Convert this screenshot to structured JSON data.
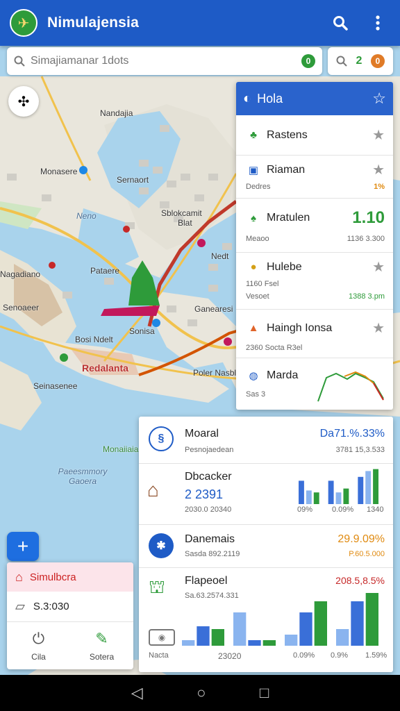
{
  "app": {
    "title": "Nimulajensia"
  },
  "search": {
    "placeholder": "Simajiamanar 1dots",
    "badge": "0",
    "right_value": "2",
    "right_badge": "0"
  },
  "map_labels": [
    {
      "text": "Nandajia",
      "cls": ""
    },
    {
      "text": "Monasere",
      "cls": ""
    },
    {
      "text": "Sernaort",
      "cls": ""
    },
    {
      "text": "Neno",
      "cls": "water"
    },
    {
      "text": "Sblokcamit",
      "cls": ""
    },
    {
      "text": "Blat",
      "cls": ""
    },
    {
      "text": "Nedt",
      "cls": ""
    },
    {
      "text": "Pataere",
      "cls": ""
    },
    {
      "text": "Nagadiano",
      "cls": ""
    },
    {
      "text": "Ganearesi",
      "cls": ""
    },
    {
      "text": "Sonisa",
      "cls": ""
    },
    {
      "text": "Bosi Ndelt",
      "cls": ""
    },
    {
      "text": "Senoaeer",
      "cls": ""
    },
    {
      "text": "Redalanta",
      "cls": "red"
    },
    {
      "text": "Poler Nasbl",
      "cls": ""
    },
    {
      "text": "Seinasenee",
      "cls": ""
    },
    {
      "text": "Monaiiaia",
      "cls": "green"
    },
    {
      "text": "Paeesmmory Gaoera",
      "cls": "water"
    }
  ],
  "panel": {
    "title": "Hola",
    "items": [
      {
        "name": "Rastens",
        "sub": "",
        "value": "",
        "star": true,
        "icon": "tree-icon"
      },
      {
        "name": "Riaman",
        "sub": "Dedres",
        "value": "1%",
        "star": true,
        "icon": "building-icon"
      },
      {
        "name": "Mratulen",
        "sub": "Meaoo",
        "value": "1.10",
        "sub_value": "1136 3.300",
        "star": false,
        "icon": "forest-icon"
      },
      {
        "name": "Hulebe",
        "sub": "1160 Fsel",
        "value": "",
        "sub2": "Vesoet",
        "sub2_value": "1388 3.pm",
        "star": true,
        "icon": "coin-icon"
      },
      {
        "name": "Haingh Ionsa",
        "sub": "2360 Socta R3el",
        "value": "",
        "star": true,
        "icon": "tent-icon"
      },
      {
        "name": "Marda",
        "sub": "Sas 3",
        "value": "",
        "star": false,
        "icon": "globe-icon"
      }
    ]
  },
  "card": {
    "sec1": {
      "title": "Moaral",
      "sub": "Pesnojaedean",
      "value": "Da71.%.33%",
      "sub_value": "3781 15,3.533"
    },
    "sec2": {
      "title": "Dbcacker",
      "value": "2 2391",
      "sub": "2030.0 20340",
      "bar_labels": [
        "09%",
        "0.09%",
        "1340"
      ]
    },
    "sec3": {
      "title": "Danemais",
      "sub": "Sasda 892.2119",
      "value": "29.9.09%",
      "sub_value": "P.60.5.000"
    },
    "sec4": {
      "title": "Flapeoel",
      "sub": "Sa.63.2574.331",
      "value": "208.5,8.5%",
      "foot_left": "Nacta",
      "foot_mid": "23020",
      "bar_labels": [
        "0.09%",
        "0.9%",
        "1.59%"
      ]
    }
  },
  "left_card": {
    "title": "Simulbcra",
    "value": "S.3:030",
    "action1": "Cila",
    "action2": "Sotera"
  },
  "colors": {
    "appbar": "#1e5bc6",
    "accent_green": "#2e9b3a",
    "accent_blue": "#2a63cc",
    "value_orange": "#e08a10"
  }
}
